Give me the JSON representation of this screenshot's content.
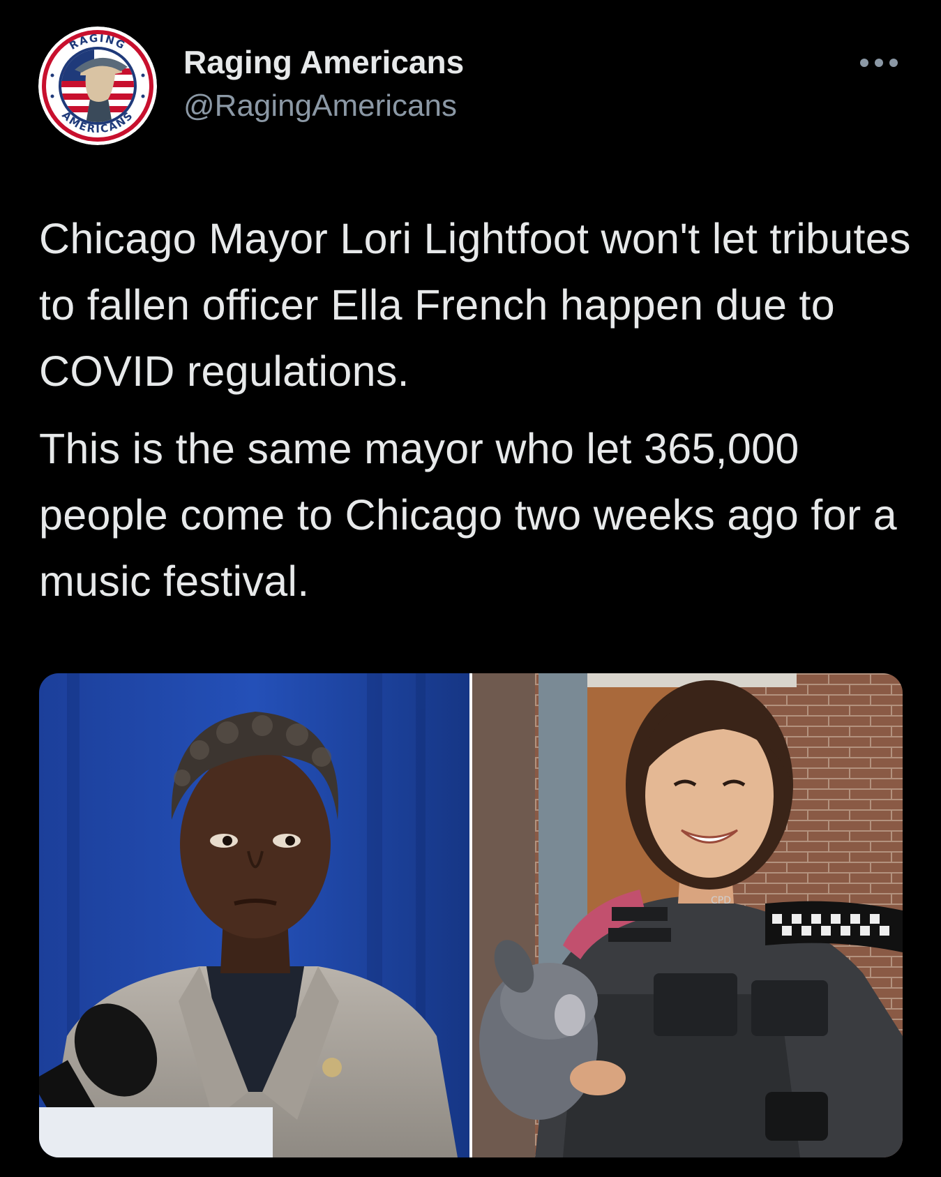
{
  "account": {
    "display_name": "Raging Americans",
    "handle": "@RagingAmericans",
    "avatar_icon": "raging-americans-logo",
    "avatar_logo_text_top": "RAGING",
    "avatar_logo_text_bottom": "AMERICANS"
  },
  "actions": {
    "more_icon": "more-horizontal-icon"
  },
  "tweet": {
    "paragraphs": [
      "Chicago Mayor Lori Lightfoot won't let tributes to fallen officer Ella French happen due to COVID regulations.",
      "This is the same mayor who let 365,000 people come to Chicago two weeks ago for a music festival."
    ]
  },
  "media": {
    "photos": [
      {
        "description_icon": "photo-lori-lightfoot"
      },
      {
        "description_icon": "photo-ella-french",
        "badge_text": "CPD"
      }
    ]
  },
  "colors": {
    "background": "#000000",
    "text_primary": "#e7e9ea",
    "text_secondary": "#8b98a5",
    "logo_red": "#c8102e",
    "logo_blue": "#1f3a7a"
  }
}
